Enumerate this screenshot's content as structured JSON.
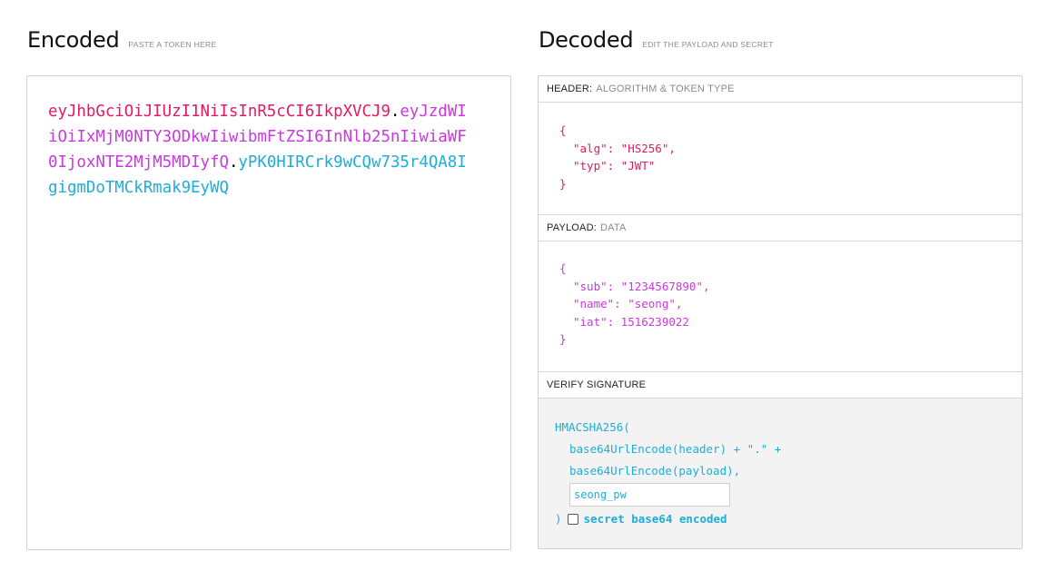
{
  "encoded": {
    "title": "Encoded",
    "subtitle": "PASTE A TOKEN HERE",
    "token_header": "eyJhbGciOiJIUzI1NiIsInR5cCI6IkpXVCJ9",
    "dot1": ".",
    "token_payload": "eyJzdWIiOiIxMjM0NTY3ODkwIiwibmFtZSI6InNlb25nIiwiaWF0IjoxNTE2MjM5MDIyfQ",
    "dot2": ".",
    "token_signature": "yPK0HIRCrk9wCQw735r4QA8IgigmDoTMCkRmak9EyWQ",
    "colors": {
      "header": "#e5195f",
      "payload": "#c938e0",
      "signature": "#1eadd8"
    }
  },
  "decoded": {
    "title": "Decoded",
    "subtitle": "EDIT THE PAYLOAD AND SECRET",
    "header_section": {
      "label": "HEADER:",
      "sublabel": "ALGORITHM & TOKEN TYPE",
      "open": "{",
      "lines": [
        "\"alg\": \"HS256\",",
        "\"typ\": \"JWT\""
      ],
      "close": "}"
    },
    "payload_section": {
      "label": "PAYLOAD:",
      "sublabel": "DATA",
      "open": "{",
      "lines": [
        "\"sub\": \"1234567890\",",
        "\"name\": \"seong\",",
        "\"iat\": 1516239022"
      ],
      "close": "}"
    },
    "verify_section": {
      "label": "VERIFY SIGNATURE",
      "fn": "HMACSHA256(",
      "line1": "base64UrlEncode(header) + \".\" +",
      "line2": "base64UrlEncode(payload),",
      "secret_value": "seong_pw",
      "close": ")",
      "checkbox_label": "secret base64 encoded",
      "checkbox_checked": false
    }
  }
}
